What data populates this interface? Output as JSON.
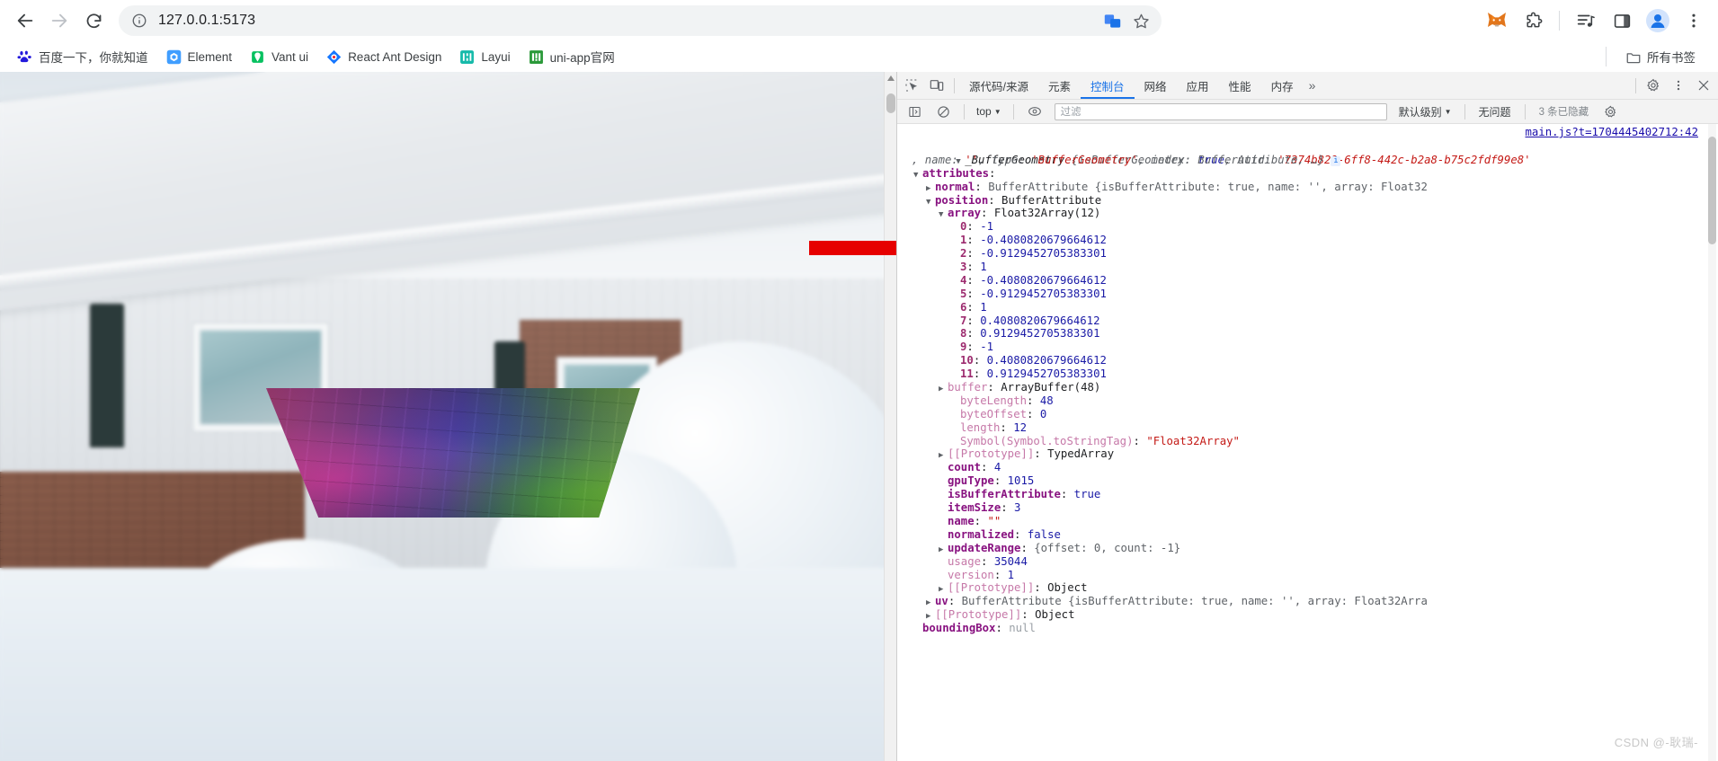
{
  "browser": {
    "nav": {
      "back": "back-arrow",
      "forward": "forward-arrow",
      "reload": "reload-icon"
    },
    "omnibox": {
      "info_icon": "info-circle-icon",
      "url": "127.0.0.1:5173",
      "translate_icon": "translate-icon",
      "bookmark_icon": "star-icon"
    },
    "extensions": [
      {
        "name": "metamask-extension-icon",
        "label": "MetaMask"
      },
      {
        "name": "puzzle-extension-icon",
        "label": "扩展程序"
      },
      {
        "name": "media-list-icon",
        "label": "媒体控件"
      },
      {
        "name": "side-panel-icon",
        "label": "侧边栏"
      },
      {
        "name": "profile-avatar-icon",
        "label": "个人资料"
      },
      {
        "name": "kebab-menu-icon",
        "label": "自定义及控制"
      }
    ],
    "bookmarks": [
      {
        "label": "百度一下，你就知道",
        "icon": "baidu-favicon"
      },
      {
        "label": "Element",
        "icon": "element-favicon"
      },
      {
        "label": "Vant ui",
        "icon": "vant-favicon"
      },
      {
        "label": "React Ant Design",
        "icon": "antdesign-favicon"
      },
      {
        "label": "Layui",
        "icon": "layui-favicon"
      },
      {
        "label": "uni-app官网",
        "icon": "uniapp-favicon"
      }
    ],
    "all_bookmarks": {
      "label": "所有书签",
      "icon": "folder-icon"
    }
  },
  "page": {
    "scene_description": "three.js 纹理平面渲染在雪景房屋背景上",
    "annotation_arrow": "red-arrow-annotation"
  },
  "devtools": {
    "tabs": [
      {
        "label": "源代码/来源",
        "active": false
      },
      {
        "label": "元素",
        "active": false
      },
      {
        "label": "控制台",
        "active": true
      },
      {
        "label": "网络",
        "active": false
      },
      {
        "label": "应用",
        "active": false
      },
      {
        "label": "性能",
        "active": false
      },
      {
        "label": "内存",
        "active": false
      }
    ],
    "more_tabs": "»",
    "left_icons": [
      {
        "name": "inspect-element-icon"
      },
      {
        "name": "device-toolbar-icon"
      }
    ],
    "right_icons": [
      {
        "name": "settings-gear-icon"
      },
      {
        "name": "kebab-menu-icon"
      },
      {
        "name": "close-icon"
      }
    ],
    "console_toolbar": {
      "sidebar_icon": "console-sidebar-icon",
      "clear_icon": "clear-console-icon",
      "context": "top",
      "context_caret": "▼",
      "eye_icon": "live-expression-icon",
      "filter_placeholder": "过滤",
      "filter_value": "",
      "level": "默认级别",
      "level_caret": "▼",
      "issues": "无问题",
      "hidden_count": "3 条已隐藏",
      "settings_icon": "settings-gear-icon"
    },
    "console": {
      "source_link": "main.js?t=1704445402712:42",
      "header": {
        "triangle": "▼",
        "class_name": "_BufferGeometry",
        "preview": " {isBufferGeometry: ",
        "preview_bool": "true",
        "preview_mid": ", uuid: ",
        "uuid": "'7374b829-6ff8-442c-b2a8-b75c2fdf99e8'",
        "preview_tail_1": ", name: ",
        "empty_str": "''",
        "preview_tail_2": ", type: ",
        "type_str": "'BufferGeometry'",
        "preview_tail_3": ", index: BufferAttribute, …}",
        "info_badge": "i"
      },
      "rows": [
        {
          "indent": 1,
          "tri": "▼",
          "key": "attributes",
          "keyclass": "k-name",
          "sep": ":",
          "value": "",
          "valclass": ""
        },
        {
          "indent": 2,
          "tri": "▶",
          "key": "normal",
          "keyclass": "k-name",
          "sep": ": ",
          "value": "BufferAttribute {isBufferAttribute: true, name: '', array: Float32",
          "valclass": "obj-prev"
        },
        {
          "indent": 2,
          "tri": "▼",
          "key": "position",
          "keyclass": "k-name",
          "sep": ": ",
          "value": "BufferAttribute",
          "valclass": "v-cls"
        },
        {
          "indent": 3,
          "tri": "▼",
          "key": "array",
          "keyclass": "k-name",
          "sep": ": ",
          "value": "Float32Array(12)",
          "valclass": "v-cls"
        },
        {
          "indent": 4,
          "tri": "",
          "key": "0",
          "keyclass": "v-idx",
          "sep": ": ",
          "value": "-1",
          "valclass": "v-num"
        },
        {
          "indent": 4,
          "tri": "",
          "key": "1",
          "keyclass": "v-idx",
          "sep": ": ",
          "value": "-0.4080820679664612",
          "valclass": "v-num"
        },
        {
          "indent": 4,
          "tri": "",
          "key": "2",
          "keyclass": "v-idx",
          "sep": ": ",
          "value": "-0.9129452705383301",
          "valclass": "v-num"
        },
        {
          "indent": 4,
          "tri": "",
          "key": "3",
          "keyclass": "v-idx",
          "sep": ": ",
          "value": "1",
          "valclass": "v-num"
        },
        {
          "indent": 4,
          "tri": "",
          "key": "4",
          "keyclass": "v-idx",
          "sep": ": ",
          "value": "-0.4080820679664612",
          "valclass": "v-num"
        },
        {
          "indent": 4,
          "tri": "",
          "key": "5",
          "keyclass": "v-idx",
          "sep": ": ",
          "value": "-0.9129452705383301",
          "valclass": "v-num"
        },
        {
          "indent": 4,
          "tri": "",
          "key": "6",
          "keyclass": "v-idx",
          "sep": ": ",
          "value": "1",
          "valclass": "v-num"
        },
        {
          "indent": 4,
          "tri": "",
          "key": "7",
          "keyclass": "v-idx",
          "sep": ": ",
          "value": "0.4080820679664612",
          "valclass": "v-num"
        },
        {
          "indent": 4,
          "tri": "",
          "key": "8",
          "keyclass": "v-idx",
          "sep": ": ",
          "value": "0.9129452705383301",
          "valclass": "v-num"
        },
        {
          "indent": 4,
          "tri": "",
          "key": "9",
          "keyclass": "v-idx",
          "sep": ": ",
          "value": "-1",
          "valclass": "v-num"
        },
        {
          "indent": 4,
          "tri": "",
          "key": "10",
          "keyclass": "v-idx",
          "sep": ": ",
          "value": "0.4080820679664612",
          "valclass": "v-num"
        },
        {
          "indent": 4,
          "tri": "",
          "key": "11",
          "keyclass": "v-idx",
          "sep": ": ",
          "value": "0.9129452705383301",
          "valclass": "v-num"
        },
        {
          "indent": 3,
          "tri": "▶",
          "key": "buffer",
          "keyclass": "k-plain",
          "sep": ": ",
          "value": "ArrayBuffer(48)",
          "valclass": "v-cls"
        },
        {
          "indent": 4,
          "tri": "",
          "key": "byteLength",
          "keyclass": "k-plain",
          "sep": ": ",
          "value": "48",
          "valclass": "v-num"
        },
        {
          "indent": 4,
          "tri": "",
          "key": "byteOffset",
          "keyclass": "k-plain",
          "sep": ": ",
          "value": "0",
          "valclass": "v-num"
        },
        {
          "indent": 4,
          "tri": "",
          "key": "length",
          "keyclass": "k-plain",
          "sep": ": ",
          "value": "12",
          "valclass": "v-num"
        },
        {
          "indent": 4,
          "tri": "",
          "key": "Symbol(Symbol.toStringTag)",
          "keyclass": "k-plain",
          "sep": ": ",
          "value": "\"Float32Array\"",
          "valclass": "v-str"
        },
        {
          "indent": 3,
          "tri": "▶",
          "key": "[[Prototype]]",
          "keyclass": "k-plain",
          "sep": ": ",
          "value": "TypedArray",
          "valclass": "v-cls"
        },
        {
          "indent": 3,
          "tri": "",
          "key": "count",
          "keyclass": "k-name",
          "sep": ": ",
          "value": "4",
          "valclass": "v-num"
        },
        {
          "indent": 3,
          "tri": "",
          "key": "gpuType",
          "keyclass": "k-name",
          "sep": ": ",
          "value": "1015",
          "valclass": "v-num"
        },
        {
          "indent": 3,
          "tri": "",
          "key": "isBufferAttribute",
          "keyclass": "k-name",
          "sep": ": ",
          "value": "true",
          "valclass": "v-bool"
        },
        {
          "indent": 3,
          "tri": "",
          "key": "itemSize",
          "keyclass": "k-name",
          "sep": ": ",
          "value": "3",
          "valclass": "v-num"
        },
        {
          "indent": 3,
          "tri": "",
          "key": "name",
          "keyclass": "k-name",
          "sep": ": ",
          "value": "\"\"",
          "valclass": "v-str"
        },
        {
          "indent": 3,
          "tri": "",
          "key": "normalized",
          "keyclass": "k-name",
          "sep": ": ",
          "value": "false",
          "valclass": "v-bool"
        },
        {
          "indent": 3,
          "tri": "▶",
          "key": "updateRange",
          "keyclass": "k-name",
          "sep": ": ",
          "value": "{offset: 0, count: -1}",
          "valclass": "obj-prev"
        },
        {
          "indent": 3,
          "tri": "",
          "key": "usage",
          "keyclass": "k-plain",
          "sep": ": ",
          "value": "35044",
          "valclass": "v-num"
        },
        {
          "indent": 3,
          "tri": "",
          "key": "version",
          "keyclass": "k-plain",
          "sep": ": ",
          "value": "1",
          "valclass": "v-num"
        },
        {
          "indent": 3,
          "tri": "▶",
          "key": "[[Prototype]]",
          "keyclass": "k-plain",
          "sep": ": ",
          "value": "Object",
          "valclass": "v-cls"
        },
        {
          "indent": 2,
          "tri": "▶",
          "key": "uv",
          "keyclass": "k-name",
          "sep": ": ",
          "value": "BufferAttribute {isBufferAttribute: true, name: '', array: Float32Arra",
          "valclass": "obj-prev"
        },
        {
          "indent": 2,
          "tri": "▶",
          "key": "[[Prototype]]",
          "keyclass": "k-plain",
          "sep": ": ",
          "value": "Object",
          "valclass": "v-cls"
        },
        {
          "indent": 1,
          "tri": "",
          "key": "boundingBox",
          "keyclass": "k-name",
          "sep": ": ",
          "value": "null",
          "valclass": "k-grey"
        }
      ]
    },
    "watermark": "CSDN @-耿瑞-"
  },
  "colors": {
    "accent": "#1a73e8",
    "chrome_bg": "#ffffff",
    "omnibox_bg": "#f1f3f4",
    "devtools_bg": "#f3f3f3",
    "arrow_red": "#e60000",
    "key_purple": "#881280",
    "string_red": "#c41a16",
    "number_blue": "#1a1aa6"
  }
}
